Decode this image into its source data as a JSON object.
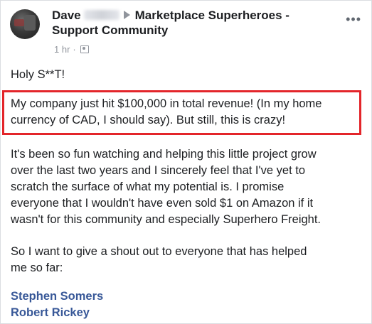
{
  "post": {
    "author_first": "Dave",
    "group_name_line1": "Marketplace Superheroes -",
    "group_name_line2": "Support Community",
    "time": "1 hr",
    "separator": "·",
    "more_label": "•••",
    "paragraphs": {
      "p1": "Holy S**T!",
      "p2_l1": "My company just hit $100,000 in total revenue! (In my home",
      "p2_l2": "currency of CAD, I should say). But still, this is crazy!",
      "p3_l1": "It's been so fun watching and helping this little project grow",
      "p3_l2": "over the last two years and I sincerely feel that I've yet to",
      "p3_l3": "scratch the surface of what my potential is. I promise",
      "p3_l4": "everyone that I wouldn't have even sold $1 on Amazon if it",
      "p3_l5": "wasn't for this community and especially Superhero Freight.",
      "p4_l1": "So I want to give a shout out to everyone that has helped",
      "p4_l2": "me so far:"
    },
    "mentions": [
      "Stephen Somers",
      "Robert Rickey"
    ]
  },
  "colors": {
    "highlight": "#e3252a",
    "link": "#385898",
    "meta": "#90949c"
  },
  "icons": {
    "audience": "group-icon",
    "more": "more-options-icon",
    "arrow": "arrow-right-icon"
  }
}
